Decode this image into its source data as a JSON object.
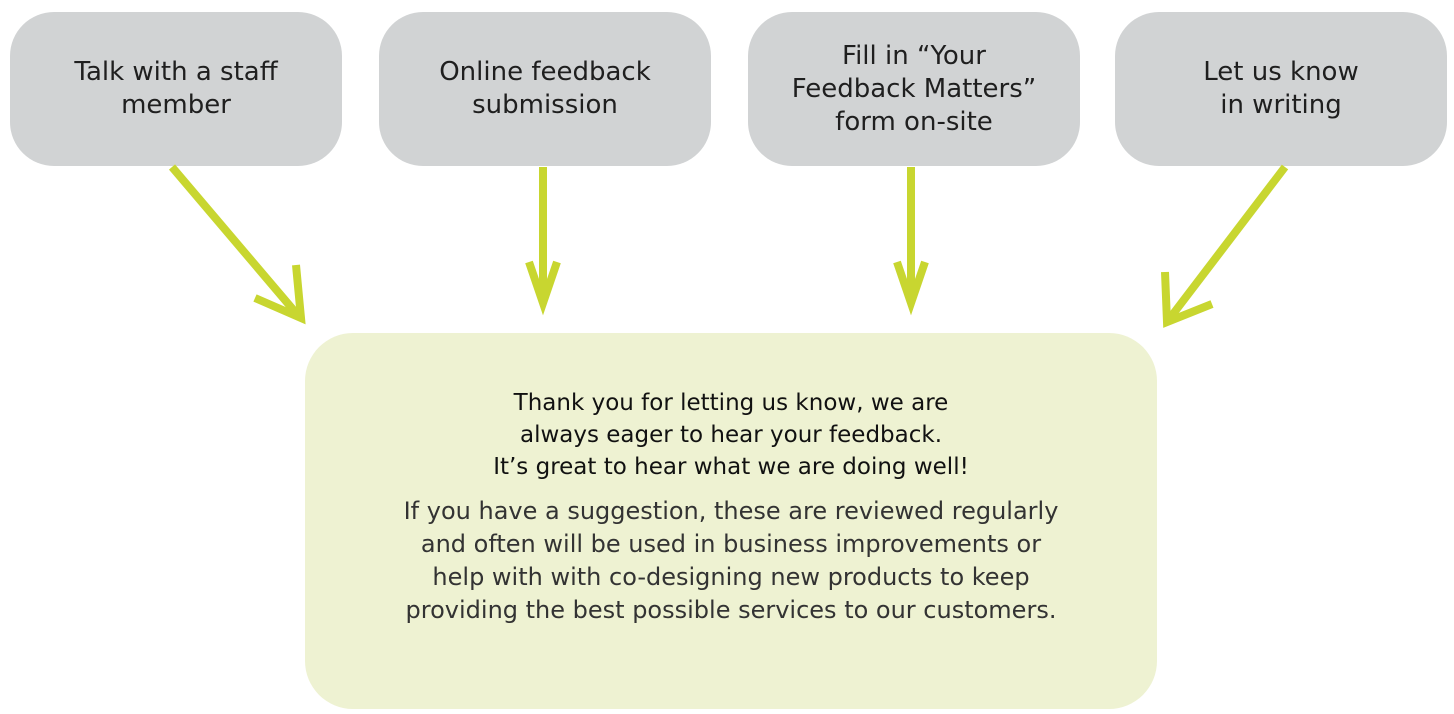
{
  "colors": {
    "source_box_fill": "#d1d3d4",
    "result_box_fill": "#eef2d2",
    "arrow": "#c8d630"
  },
  "sources": [
    {
      "label": "Talk with a staff\nmember"
    },
    {
      "label": "Online feedback\nsubmission"
    },
    {
      "label": "Fill in “Your\nFeedback Matters”\nform on-site"
    },
    {
      "label": "Let us know\nin writing"
    }
  ],
  "result": {
    "heading": "Thank you for letting us know, we are\nalways eager to hear your feedback.\nIt’s great to hear what we are doing well!",
    "body": "If you have a suggestion, these are reviewed regularly\nand often will be used in business improvements or\nhelp with with co-designing new products to keep\nproviding the best possible services to our customers."
  }
}
